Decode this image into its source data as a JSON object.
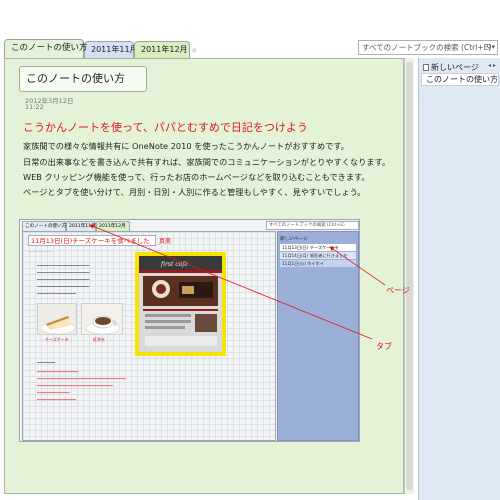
{
  "tabs": [
    {
      "label": "このノートの使い方"
    },
    {
      "label": "2011年11月"
    },
    {
      "label": "2011年12月"
    }
  ],
  "search": {
    "placeholder": "すべてのノートブックの検索 (Ctrl+E)"
  },
  "page": {
    "title": "このノートの使い方",
    "date": "2012年3月12日",
    "time": "11:22",
    "headline": "こうかんノートを使って、パパとむすめで日記をつけよう",
    "body": [
      "家族間での様々な情報共有に OneNote 2010 を使ったこうかんノートがおすすめです。",
      "日常の出来事などを書き込んで共有すれば、家族間でのコミュニケーションがとりやすくなります。",
      "WEB クリッピング機能を使って、行ったお店のホームページなどを取り込むこともできます。",
      "ページとタブを使い分けて、月別・日別・人別に作ると管理もしやすく、見やすいでしょう。"
    ]
  },
  "right_panel": {
    "new_page_label": "新しいページ",
    "pages": [
      "このノートの使い方"
    ]
  },
  "annotations": {
    "page_label": "ページ",
    "tab_label": "タブ"
  },
  "embedded": {
    "tabs": [
      "このノートの使い方",
      "2011年11月",
      "2011年12月"
    ],
    "search": "すべてのノートブックの検索 (Ctrl+E)",
    "title": "11月13日(日)チーズケーキを食べました",
    "author": "真美",
    "new_page": "新しいページ",
    "pages": [
      "11月13日(日) チーズケーキを",
      "11月14日(月) 歯医者に行きました",
      "11月1日(火) ホイホイ"
    ],
    "cafe_name": "first cafe",
    "captions": [
      "チーズケーキ",
      "紅茶を"
    ]
  },
  "colors": {
    "accent_red": "#e0181b",
    "page_bg": "#e4f3d8",
    "panel_bg": "#dfe9f5",
    "highlight_yellow": "#f5e400"
  }
}
